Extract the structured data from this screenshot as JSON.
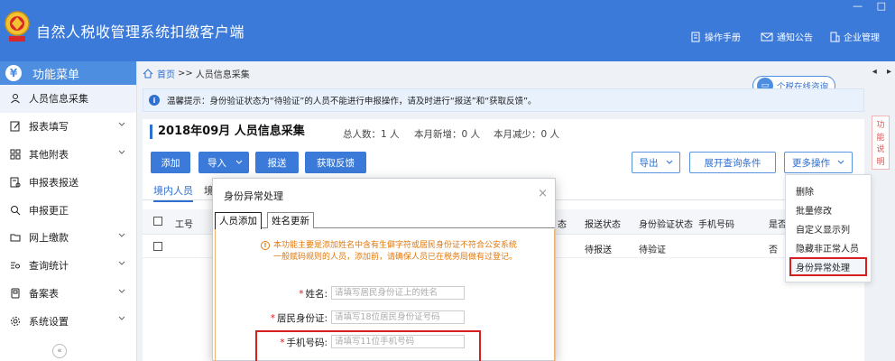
{
  "app": {
    "title": "自然人税收管理系统扣缴客户端",
    "window_controls": [
      "—",
      "□"
    ],
    "top_links": {
      "manual": "操作手册",
      "notice": "通知公告",
      "company": "企业管理"
    }
  },
  "sidebar": {
    "header": "功能菜单",
    "items": [
      {
        "label": "人员信息采集",
        "icon": "person-icon",
        "has_chevron": false
      },
      {
        "label": "报表填写",
        "icon": "edit-icon",
        "has_chevron": true
      },
      {
        "label": "其他附表",
        "icon": "grid-icon",
        "has_chevron": true
      },
      {
        "label": "申报表报送",
        "icon": "report-icon",
        "has_chevron": false
      },
      {
        "label": "申报更正",
        "icon": "search-icon",
        "has_chevron": false
      },
      {
        "label": "网上缴款",
        "icon": "folder-icon",
        "has_chevron": true
      },
      {
        "label": "查询统计",
        "icon": "list-search-icon",
        "has_chevron": true
      },
      {
        "label": "备案表",
        "icon": "document-icon",
        "has_chevron": true
      },
      {
        "label": "系统设置",
        "icon": "gear-icon",
        "has_chevron": true
      }
    ],
    "collapse_label": "«"
  },
  "breadcrumb": {
    "home": "首页",
    "sep": ">>",
    "current": "人员信息采集"
  },
  "tab_controls": [
    "◂",
    "▸"
  ],
  "consult_button": "个税在线咨询",
  "notice": "温馨提示：身份验证状态为“待验证”的人员不能进行申报操作，请及时进行“报送”和“获取反馈”。",
  "page": {
    "period_title": "2018年09月  人员信息采集",
    "stats": {
      "total": "总人数：1 人",
      "new_this_month": "本月新增：0 人",
      "reduced_this_month": "本月减少：0 人"
    },
    "buttons": {
      "add": "添加",
      "import": "导入",
      "submit": "报送",
      "get_feedback": "获取反馈",
      "export": "导出",
      "expand_query": "展开查询条件",
      "more_ops": "更多操作"
    },
    "subtabs": [
      "境内人员",
      "境"
    ],
    "table": {
      "headers": [
        "工号",
        "态",
        "报送状态",
        "身份验证状态",
        "手机号码",
        "是否"
      ],
      "rows": [
        {
          "status_tail": "",
          "submit_status": "待报送",
          "verify_status": "待验证",
          "phone": "",
          "flag": "否"
        }
      ]
    }
  },
  "more_menu": [
    "删除",
    "批量修改",
    "自定义显示列",
    "隐藏非正常人员",
    "身份异常处理"
  ],
  "func_desc": [
    "功",
    "能",
    "说",
    "明"
  ],
  "modal": {
    "title": "身份异常处理",
    "close": "×",
    "tabs": [
      "人员添加",
      "姓名更新"
    ],
    "warning": "本功能主要是添加姓名中含有生僻字符或居民身份证不符合公安系统一般赋码规则的人员，添加前，请确保人员已在税务局做有过登记。",
    "fields": [
      {
        "label": "姓名:",
        "placeholder": "请填写居民身份证上的姓名"
      },
      {
        "label": "居民身份证:",
        "placeholder": "请填写18位居民身份证号码"
      },
      {
        "label": "手机号码:",
        "placeholder": "请填写11位手机号码"
      }
    ]
  }
}
